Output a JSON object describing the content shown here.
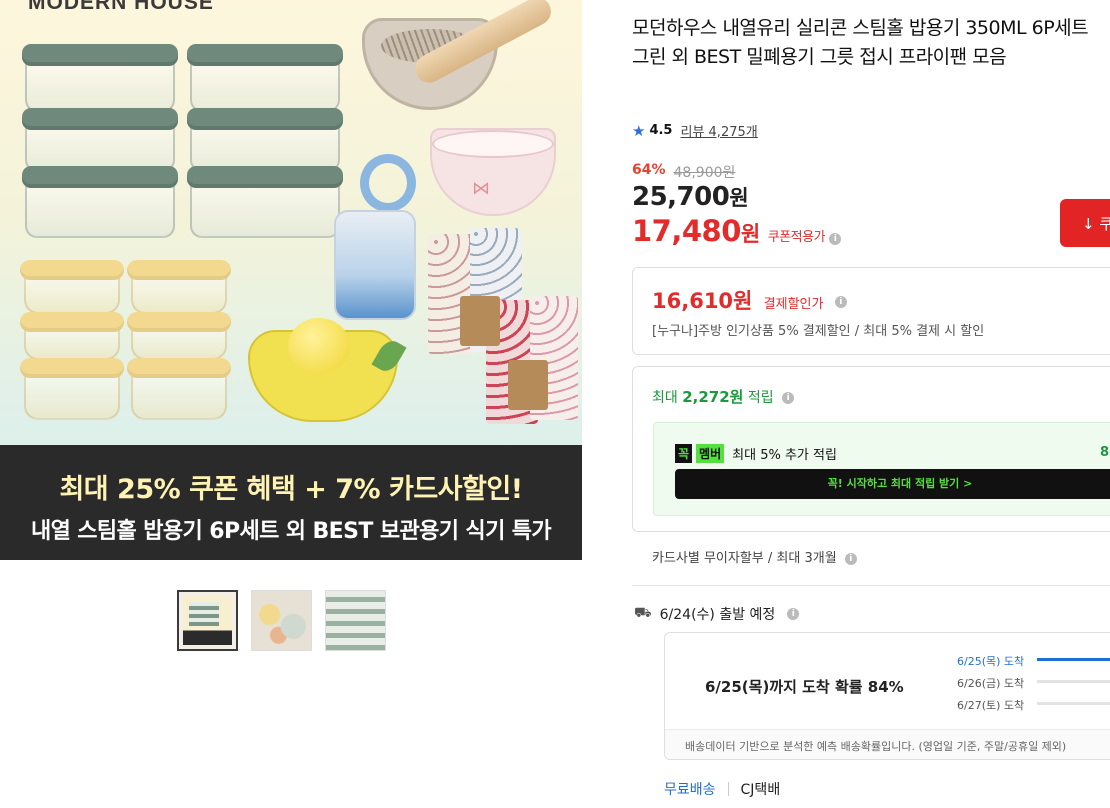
{
  "hero": {
    "brand": "MODERN HOUSE",
    "banner_line1": "최대 25% 쿠폰 혜택 + 7% 카드사할인!",
    "banner_line2": "내열 스팀홀 밥용기 6P세트 외 BEST 보관용기 식기 특가"
  },
  "thumbnails": [
    {
      "name": "thumbnail-1",
      "active": true
    },
    {
      "name": "thumbnail-2",
      "active": false
    },
    {
      "name": "thumbnail-3",
      "active": false
    }
  ],
  "product": {
    "title": "모던하우스 내열유리 실리콘 스팀홀 밥용기 350ML 6P세트 그린 외 BEST 밀폐용기 그릇 접시 프라이팬 모음",
    "rating": "4.5",
    "reviews_label": "리뷰 4,275개",
    "discount_pct": "64%",
    "original_price": "48,900원",
    "price_num": "25,700",
    "price_unit": "원",
    "coupon_price_num": "17,480",
    "coupon_price_unit": "원",
    "coupon_label": "쿠폰적용가",
    "coupon_button": "↓ 쿠"
  },
  "payment": {
    "price": "16,610원",
    "label": "결제할인가",
    "desc": "[누구나]주방 인기상품 5% 결제할인 / 최대 5% 결제 시 할인"
  },
  "reward": {
    "prefix": "최대",
    "amount": "2,272원",
    "suffix": "적립",
    "member_badge_1": "꼭",
    "member_badge_2": "멤버",
    "member_text": "최대 5% 추가 적립",
    "member_right": "8",
    "member_button": "꼭! 시작하고 최대 적립 받기 >"
  },
  "installment": "카드사별 무이자할부 / 최대 3개월",
  "shipping": {
    "departure": "6/24(수) 출발 예정",
    "forecast_main": "6/25(목)까지 도착 확률 84%",
    "rows": [
      {
        "label": "6/25(목) 도착",
        "percent": 84,
        "highlight": true
      },
      {
        "label": "6/26(금) 도착",
        "percent": 0,
        "highlight": false
      },
      {
        "label": "6/27(토) 도착",
        "percent": 0,
        "highlight": false
      }
    ],
    "note": "배송데이터 기반으로 분석한 예측 배송확률입니다. (영업일 기준, 주말/공휴일 제외)",
    "free_shipping": "무료배송",
    "carrier": "CJ택배"
  }
}
